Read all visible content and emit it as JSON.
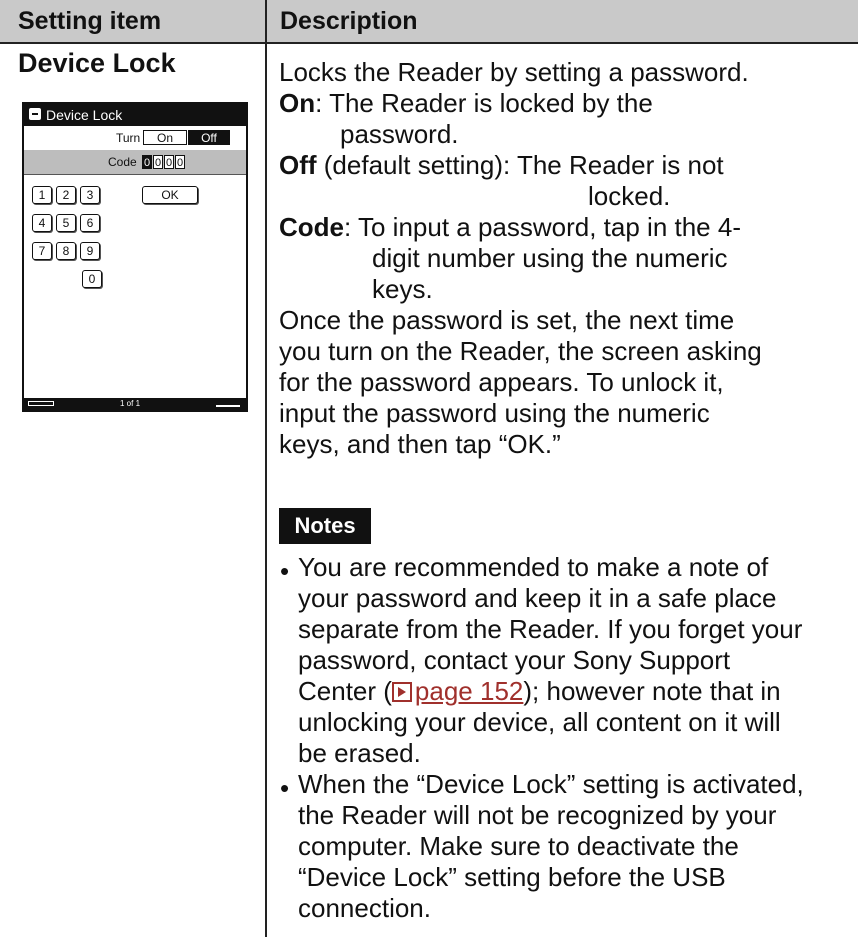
{
  "table": {
    "headers": [
      "Setting item",
      "Description"
    ]
  },
  "item": {
    "title": "Device Lock"
  },
  "device_screen": {
    "title": "Device Lock",
    "turn_label": "Turn",
    "on_label": "On",
    "off_label": "Off",
    "code_label": "Code",
    "code_digits": [
      "0",
      "0",
      "0",
      "0"
    ],
    "keys": [
      "1",
      "2",
      "3",
      "OK",
      "4",
      "5",
      "6",
      "7",
      "8",
      "9",
      "0"
    ],
    "footer_page": "1 of 1"
  },
  "description": {
    "intro": "Locks the Reader by setting a password.",
    "on_term": "On",
    "on_text_1": ": The Reader is locked by the",
    "on_text_2": "password.",
    "off_term": "Off",
    "off_text_1": " (default setting): The Reader is not",
    "off_text_2": "locked.",
    "code_term": "Code",
    "code_text_1": ": To input a password, tap in the 4-",
    "code_text_2": "digit number using the numeric",
    "code_text_3": "keys.",
    "para_lines": [
      "Once the password is set, the next time",
      "you turn on the Reader, the screen asking",
      "for the password appears. To unlock it,",
      "input the password using the numeric",
      "keys, and then tap “OK.”"
    ]
  },
  "notes": {
    "label": "Notes",
    "bullet_char": "•",
    "note1_lines": [
      "You are recommended to make a note of",
      "your password and keep it in a safe place",
      "separate from the Reader. If you forget your",
      "password, contact your Sony Support"
    ],
    "note1_center_prefix": "Center (",
    "note1_link": "page 152",
    "note1_center_suffix": "); however note that in",
    "note1_tail_lines": [
      "unlocking your device, all content on it will",
      "be erased."
    ],
    "note2_lines": [
      "When the “Device Lock” setting is activated,",
      "the Reader will not be recognized by your",
      "computer. Make sure to deactivate the",
      "“Device Lock” setting before the USB",
      "connection."
    ]
  }
}
